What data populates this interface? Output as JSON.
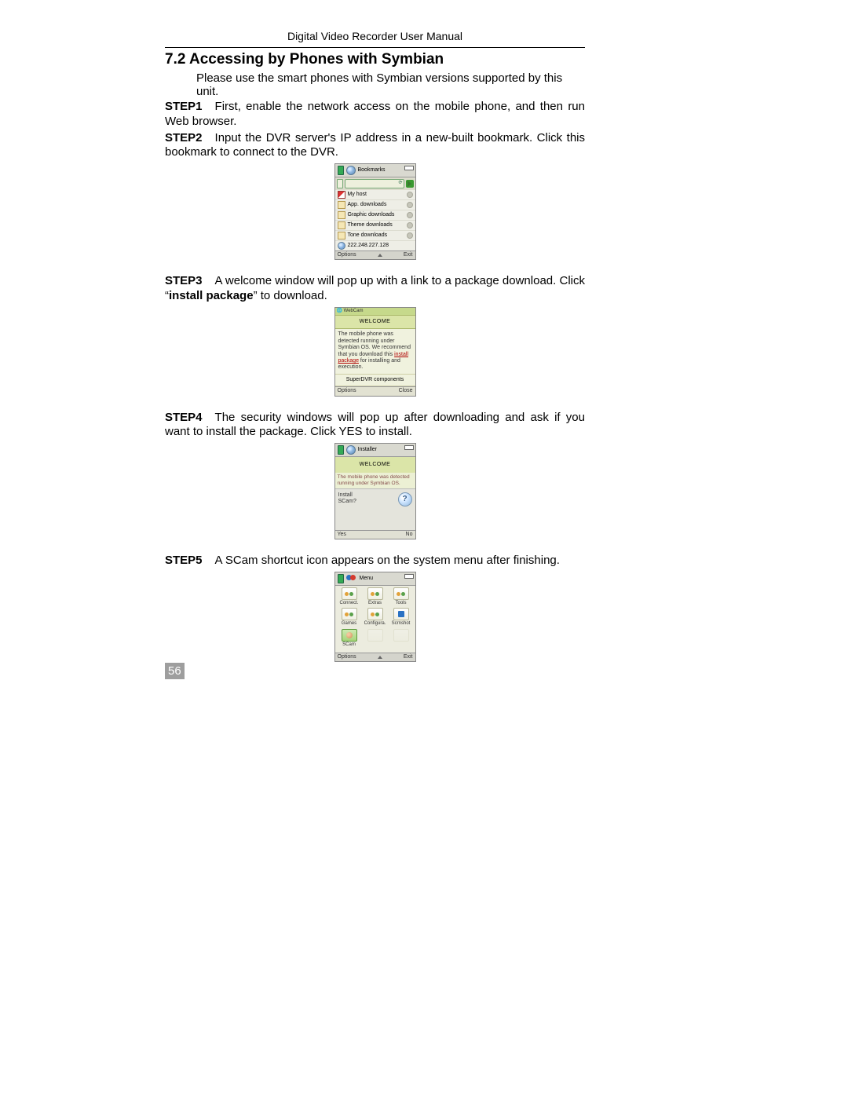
{
  "header": "Digital Video Recorder User Manual",
  "section_title": "7.2  Accessing by Phones with Symbian",
  "intro": "Please use the smart phones with Symbian versions supported by this unit.",
  "page_number": "56",
  "steps": {
    "s1": {
      "label": "STEP1",
      "text": "First, enable the network access on the mobile phone, and then run Web browser."
    },
    "s2": {
      "label": "STEP2",
      "text": "Input the DVR server's IP address in a new-built bookmark. Click this bookmark to connect to the DVR."
    },
    "s3": {
      "label": "STEP3",
      "pre": "A welcome window will pop up with a link to a package download. Click “",
      "bold": "install package",
      "post": "” to download."
    },
    "s4": {
      "label": "STEP4",
      "text": "The security windows will pop up after downloading and ask if you want to install the package. Click YES to install."
    },
    "s5": {
      "label": "STEP5",
      "text": "A SCam shortcut icon appears on the system menu after finishing."
    }
  },
  "fig1": {
    "title": "Bookmarks",
    "items": [
      {
        "label": "My host",
        "icon": "flag",
        "has_dot": true
      },
      {
        "label": "App. downloads",
        "icon": "folder",
        "has_dot": true
      },
      {
        "label": "Graphic downloads",
        "icon": "folder",
        "has_dot": true
      },
      {
        "label": "Theme downloads",
        "icon": "folder",
        "has_dot": true
      },
      {
        "label": "Tone downloads",
        "icon": "folder",
        "has_dot": true
      },
      {
        "label": "222.248.227.128",
        "icon": "globe",
        "has_dot": false
      }
    ],
    "left_soft": "Options",
    "right_soft": "Exit"
  },
  "fig2": {
    "topbar": "🌐 WebCam",
    "banner": "WELCOME",
    "msg_pre": "The mobile phone was detected running under Symbian OS. We recommend that you download this ",
    "msg_link": "install package",
    "msg_post": " for installing and execution.",
    "components": "SuperDVR components",
    "left_soft": "Options",
    "right_soft": "Close"
  },
  "fig3": {
    "title": "Installer",
    "banner": "WELCOME",
    "msg": "The mobile phone was detected running under Symbian OS.",
    "prompt_line1": "Install",
    "prompt_line2": "SCam?",
    "left_soft": "Yes",
    "right_soft": "No"
  },
  "fig4": {
    "title": "Menu",
    "apps_row1": [
      "Connect.",
      "Extras",
      "Tools"
    ],
    "apps_row2": [
      "Games",
      "Configura.",
      "Scrnshot"
    ],
    "apps_row3": [
      "SCam",
      "",
      ""
    ],
    "left_soft": "Options",
    "right_soft": "Exit"
  }
}
